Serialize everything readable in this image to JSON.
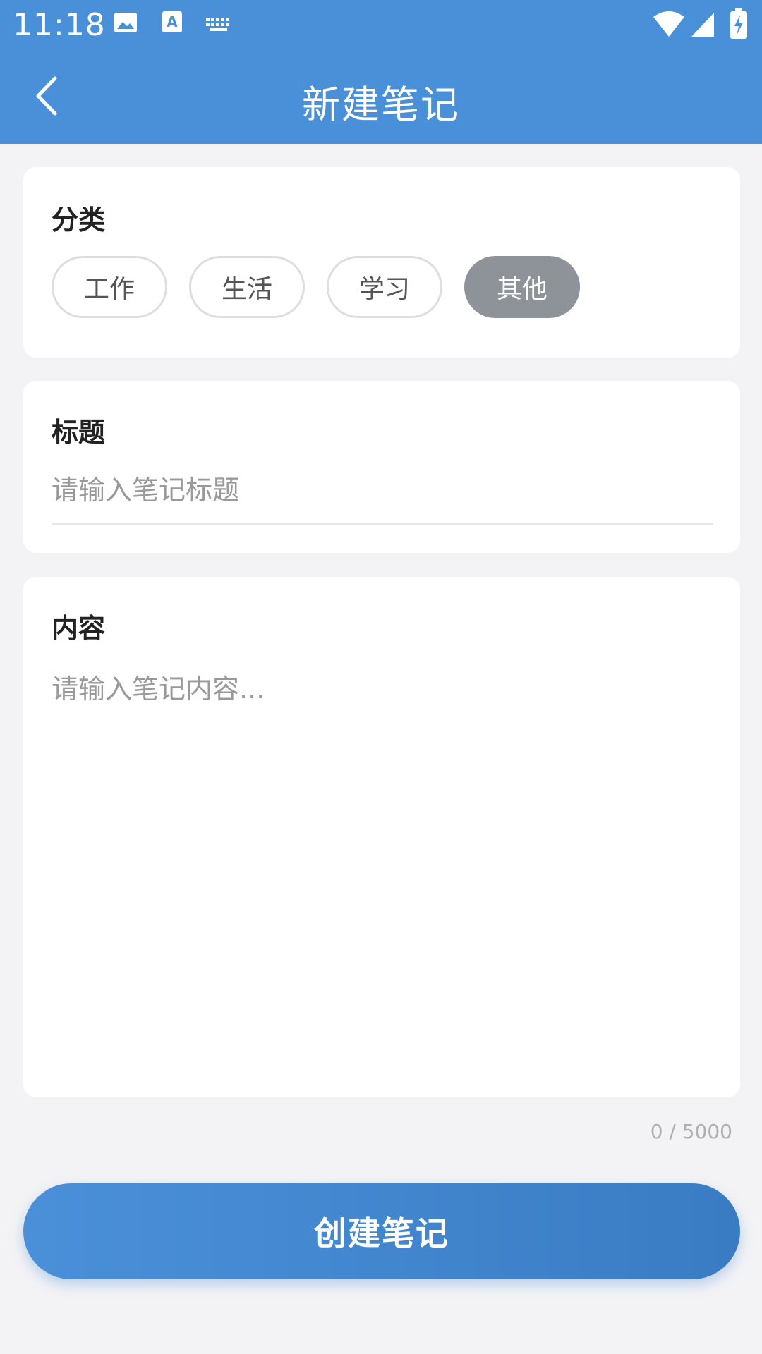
{
  "status_bar": {
    "time": "11:18",
    "left_icons": [
      "image-icon",
      "text-a-icon",
      "keyboard-icon"
    ],
    "right_icons": [
      "wifi-icon",
      "cell-signal-icon",
      "battery-charging-icon"
    ]
  },
  "app_bar": {
    "title": "新建笔记",
    "back_icon": "chevron-left-icon",
    "background_color": "#4a90d9"
  },
  "category": {
    "label": "分类",
    "options": [
      "工作",
      "生活",
      "学习",
      "其他"
    ],
    "selected": "其他"
  },
  "title_field": {
    "label": "标题",
    "placeholder": "请输入笔记标题",
    "value": ""
  },
  "content_field": {
    "label": "内容",
    "placeholder": "请输入笔记内容...",
    "value": ""
  },
  "counter": "0 / 5000",
  "submit": {
    "label": "创建笔记"
  }
}
